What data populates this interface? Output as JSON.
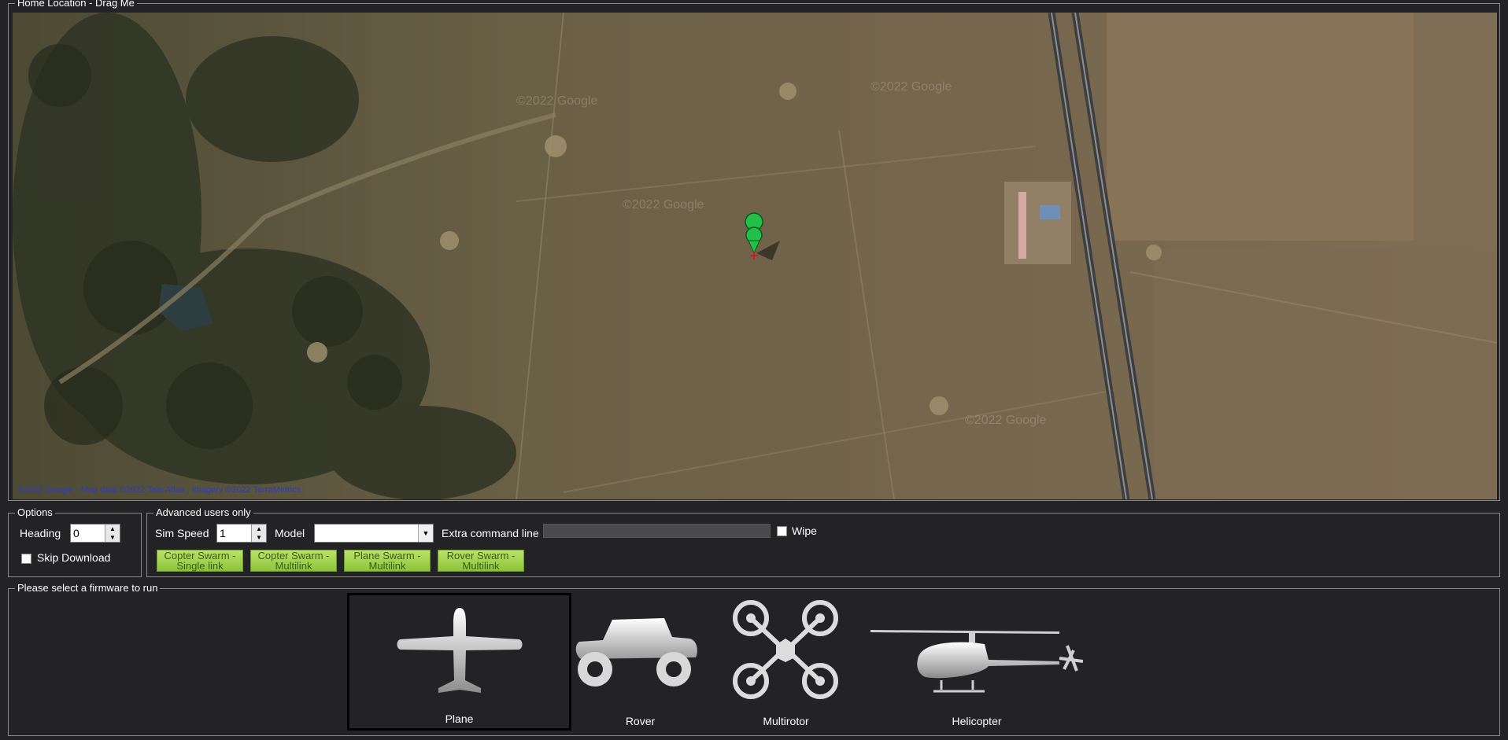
{
  "map_panel": {
    "title": "Home Location - Drag Me",
    "attribution": "©2022 Google - Map data ©2022 Tele Atlas , Imagery ©2022 TerraMetrics",
    "watermarks": [
      "©2022 Google",
      "©2022 Google",
      "©2022 Google",
      "©2022 Google"
    ],
    "marker_color": "#22c04a"
  },
  "options": {
    "title": "Options",
    "heading_label": "Heading",
    "heading_value": "0",
    "skip_download_label": "Skip Download",
    "skip_download_checked": false
  },
  "advanced": {
    "title": "Advanced users only",
    "sim_speed_label": "Sim Speed",
    "sim_speed_value": "1",
    "model_label": "Model",
    "model_value": "",
    "extra_cmd_label": "Extra command line",
    "extra_cmd_value": "",
    "wipe_label": "Wipe",
    "wipe_checked": false,
    "swarm_buttons": [
      {
        "line1": "Copter Swarm -",
        "line2": "Single link"
      },
      {
        "line1": "Copter Swarm -",
        "line2": "Multilink"
      },
      {
        "line1": "Plane Swarm -",
        "line2": "Multilink"
      },
      {
        "line1": "Rover Swarm -",
        "line2": "Multilink"
      }
    ]
  },
  "firmware": {
    "title": "Please select a firmware to run",
    "items": [
      {
        "name": "Plane",
        "icon": "plane-icon",
        "selected": true
      },
      {
        "name": "Rover",
        "icon": "rover-icon",
        "selected": false
      },
      {
        "name": "Multirotor",
        "icon": "multirotor-icon",
        "selected": false
      },
      {
        "name": "Helicopter",
        "icon": "helicopter-icon",
        "selected": false
      }
    ]
  },
  "colors": {
    "background": "#232326",
    "swarm_button": "#9fd24a",
    "map_base": "#6f6450"
  }
}
